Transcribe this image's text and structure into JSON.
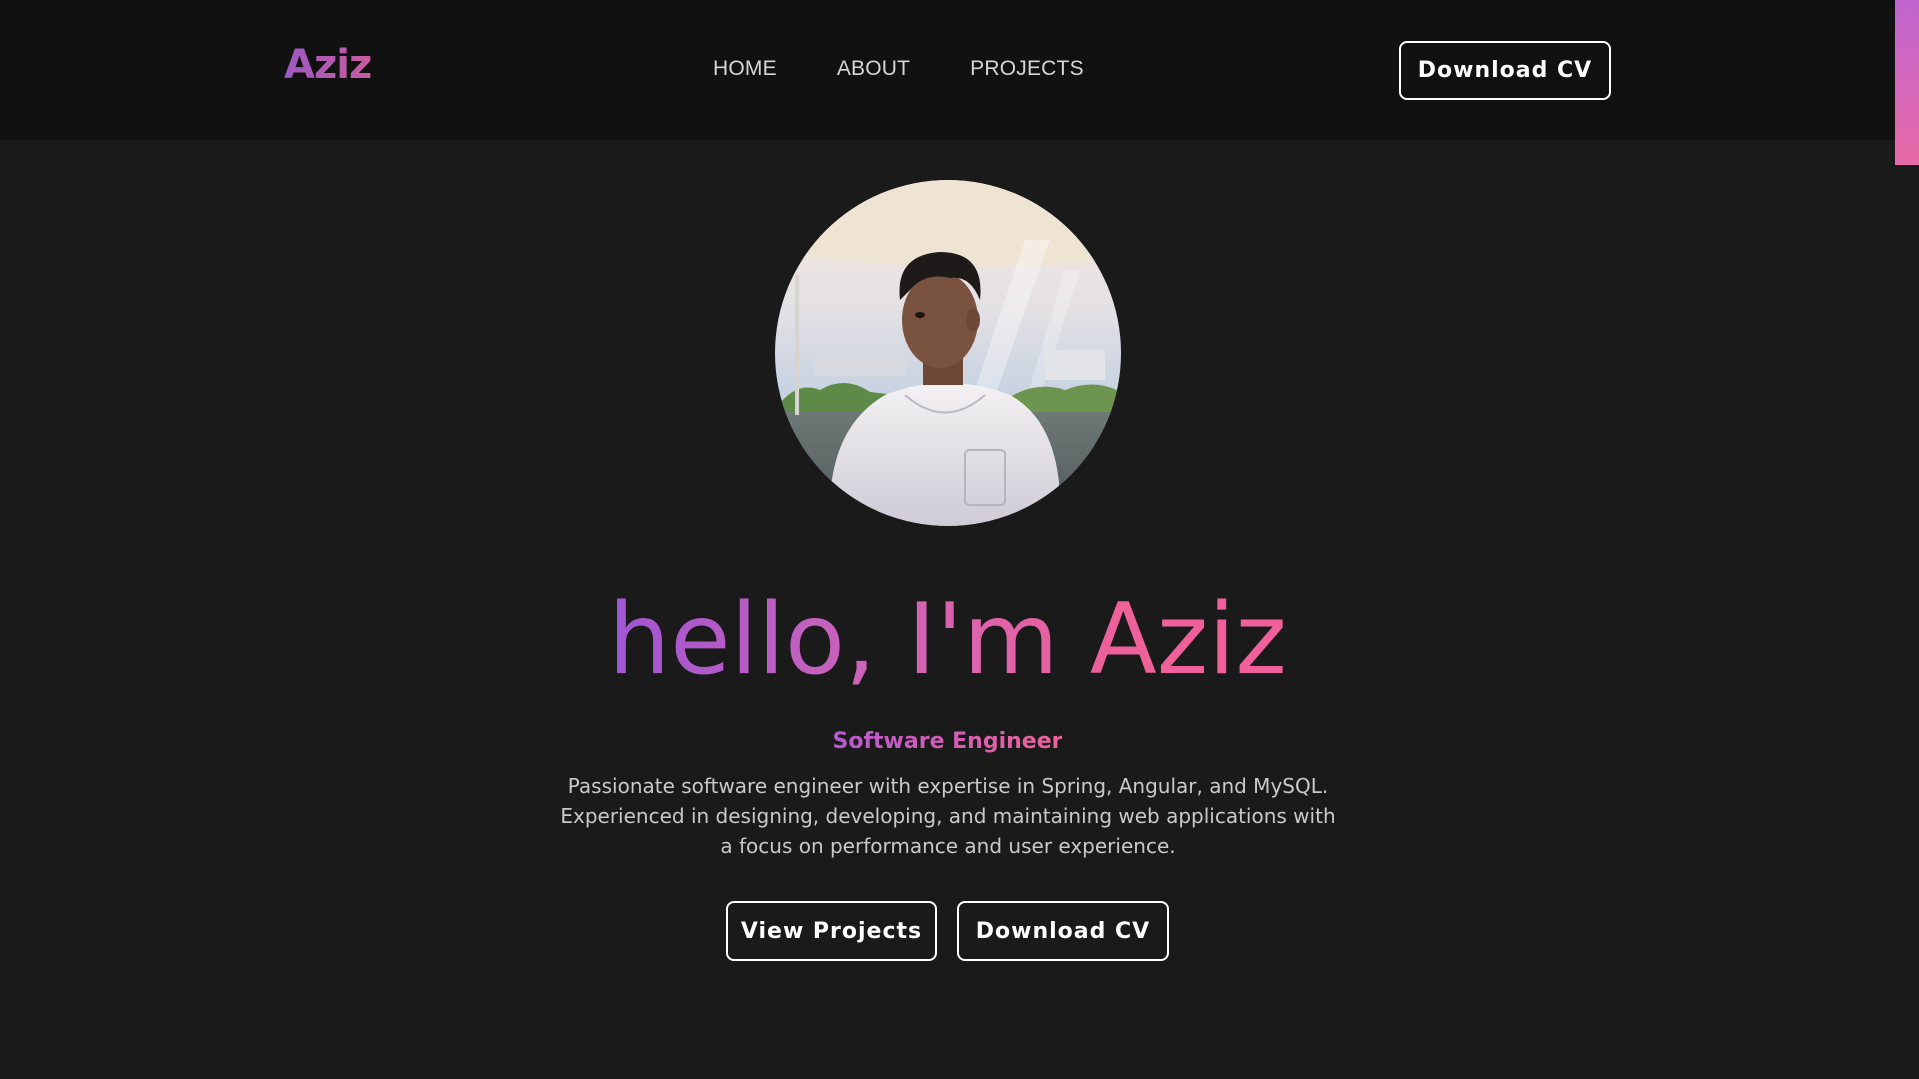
{
  "header": {
    "logo": "Aziz",
    "nav": [
      {
        "label": "HOME"
      },
      {
        "label": "ABOUT"
      },
      {
        "label": "PROJECTS"
      }
    ],
    "cta_label": "Download CV"
  },
  "hero": {
    "avatar_icon": "avatar-portrait",
    "title": "hello, I'm Aziz",
    "role": "Software Engineer",
    "description": "Passionate software engineer with expertise in Spring, Angular, and MySQL. Experienced in designing, developing, and maintaining web applications with a focus on performance and user experience.",
    "primary_button": "View Projects",
    "secondary_button": "Download CV"
  },
  "colors": {
    "background": "#1a1a1b",
    "header_background": "#111112",
    "gradient_start": "#9f55d4",
    "gradient_end": "#f0609a"
  }
}
